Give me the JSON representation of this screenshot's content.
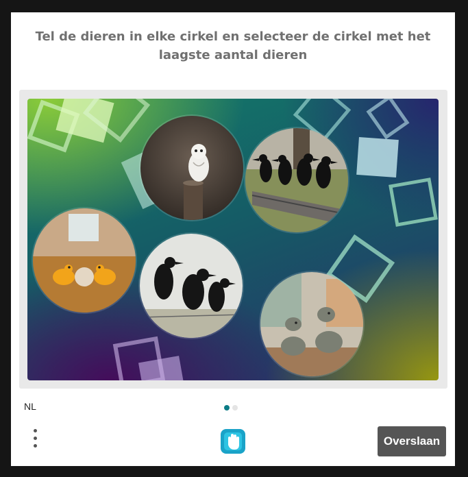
{
  "challenge": {
    "prompt": "Tel de dieren in elke cirkel en selecteer de cirkel met het laagste aantal dieren",
    "circles": [
      {
        "id": "owl",
        "animal": "owl",
        "count": 1
      },
      {
        "id": "crows-four",
        "animal": "crow",
        "count": 4
      },
      {
        "id": "frogs",
        "animal": "frog",
        "count": 2
      },
      {
        "id": "crows-three",
        "animal": "crow",
        "count": 3
      },
      {
        "id": "iguanas",
        "animal": "iguana",
        "count": 2
      }
    ]
  },
  "footer": {
    "language": "NL",
    "pagination": {
      "total": 2,
      "active": 0
    },
    "skip_label": "Overslaan",
    "menu_icon": "more-vertical-icon",
    "logo_icon": "hand-logo-icon"
  },
  "colors": {
    "dot_active": "#0c7c86",
    "dot_inactive": "#e4e4e4",
    "button": "#555555"
  }
}
